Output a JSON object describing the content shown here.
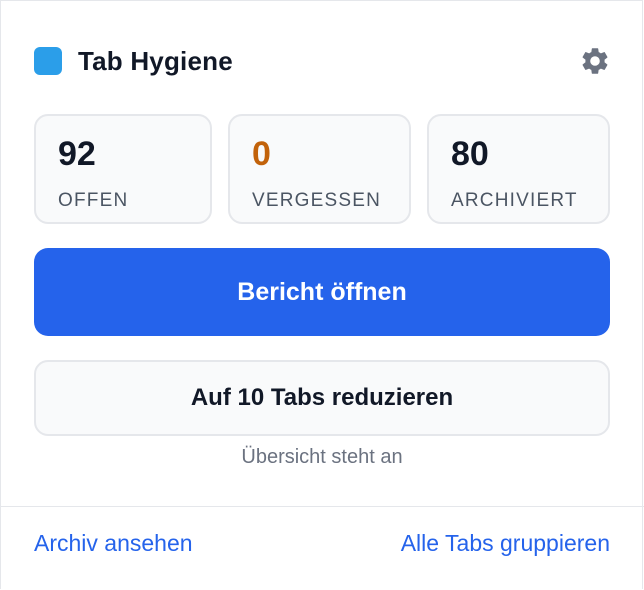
{
  "header": {
    "title": "Tab Hygiene",
    "brand_color": "#2b9ee9",
    "settings_icon": "gear-icon"
  },
  "stats": [
    {
      "value": "92",
      "label": "OFFEN"
    },
    {
      "value": "0",
      "label": "VERGESSEN",
      "color": "#c2620a"
    },
    {
      "value": "80",
      "label": "ARCHIVIERT"
    }
  ],
  "actions": {
    "primary_label": "Bericht öffnen",
    "secondary_label": "Auf 10 Tabs reduzieren",
    "note": "Übersicht steht an"
  },
  "footer": {
    "left_link": "Archiv ansehen",
    "right_link": "Alle Tabs gruppieren"
  },
  "colors": {
    "accent": "#2563eb",
    "warning": "#c2620a"
  }
}
